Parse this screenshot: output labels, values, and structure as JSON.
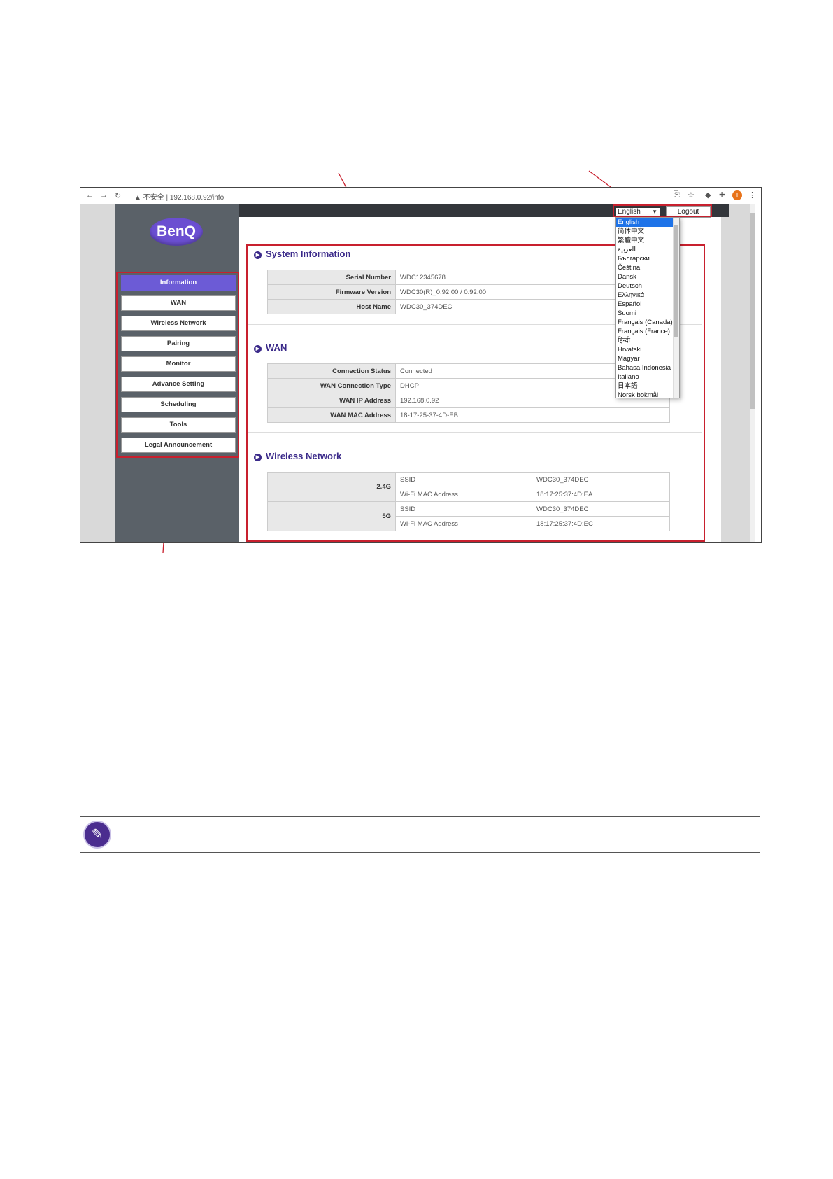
{
  "browser": {
    "address_prefix": "▲ 不安全 |",
    "url": "192.168.0.92/info",
    "avatar_letter": "I"
  },
  "brand": {
    "logo_text": "BenQ"
  },
  "sidebar": {
    "items": [
      {
        "label": "Information",
        "active": true
      },
      {
        "label": "WAN"
      },
      {
        "label": "Wireless Network"
      },
      {
        "label": "Pairing"
      },
      {
        "label": "Monitor"
      },
      {
        "label": "Advance Setting"
      },
      {
        "label": "Scheduling"
      },
      {
        "label": "Tools"
      },
      {
        "label": "Legal Announcement"
      }
    ]
  },
  "header": {
    "language_selected": "English",
    "logout_label": "Logout"
  },
  "language_options": [
    "English",
    "简体中文",
    "繁體中文",
    "العربية",
    "Български",
    "Čeština",
    "Dansk",
    "Deutsch",
    "Ελληνικά",
    "Español",
    "Suomi",
    "Français (Canada)",
    "Français (France)",
    "हिन्दी",
    "Hrvatski",
    "Magyar",
    "Bahasa Indonesia",
    "Italiano",
    "日本語",
    "Norsk bokmål"
  ],
  "system_information": {
    "title": "System Information",
    "rows": [
      {
        "key": "Serial Number",
        "value": "WDC12345678"
      },
      {
        "key": "Firmware Version",
        "value": "WDC30(R)_0.92.00 / 0.92.00"
      },
      {
        "key": "Host Name",
        "value": "WDC30_374DEC"
      }
    ]
  },
  "wan": {
    "title": "WAN",
    "rows": [
      {
        "key": "Connection Status",
        "value": "Connected"
      },
      {
        "key": "WAN Connection Type",
        "value": "DHCP"
      },
      {
        "key": "WAN IP Address",
        "value": "192.168.0.92"
      },
      {
        "key": "WAN MAC Address",
        "value": "18-17-25-37-4D-EB"
      }
    ]
  },
  "wireless": {
    "title": "Wireless Network",
    "band_24": "2.4G",
    "band_5": "5G",
    "rows_24": [
      {
        "key": "SSID",
        "value": "WDC30_374DEC"
      },
      {
        "key": "Wi-Fi MAC Address",
        "value": "18:17:25:37:4D:EA"
      }
    ],
    "rows_5": [
      {
        "key": "SSID",
        "value": "WDC30_374DEC"
      },
      {
        "key": "Wi-Fi MAC Address",
        "value": "18:17:25:37:4D:EC"
      }
    ]
  },
  "icons": {
    "note": "pencil-icon",
    "bullet": "play-circle-icon"
  },
  "colors": {
    "accent": "#6c5bd6",
    "highlight_red": "#c8202e",
    "title_purple": "#3b2a8a"
  }
}
